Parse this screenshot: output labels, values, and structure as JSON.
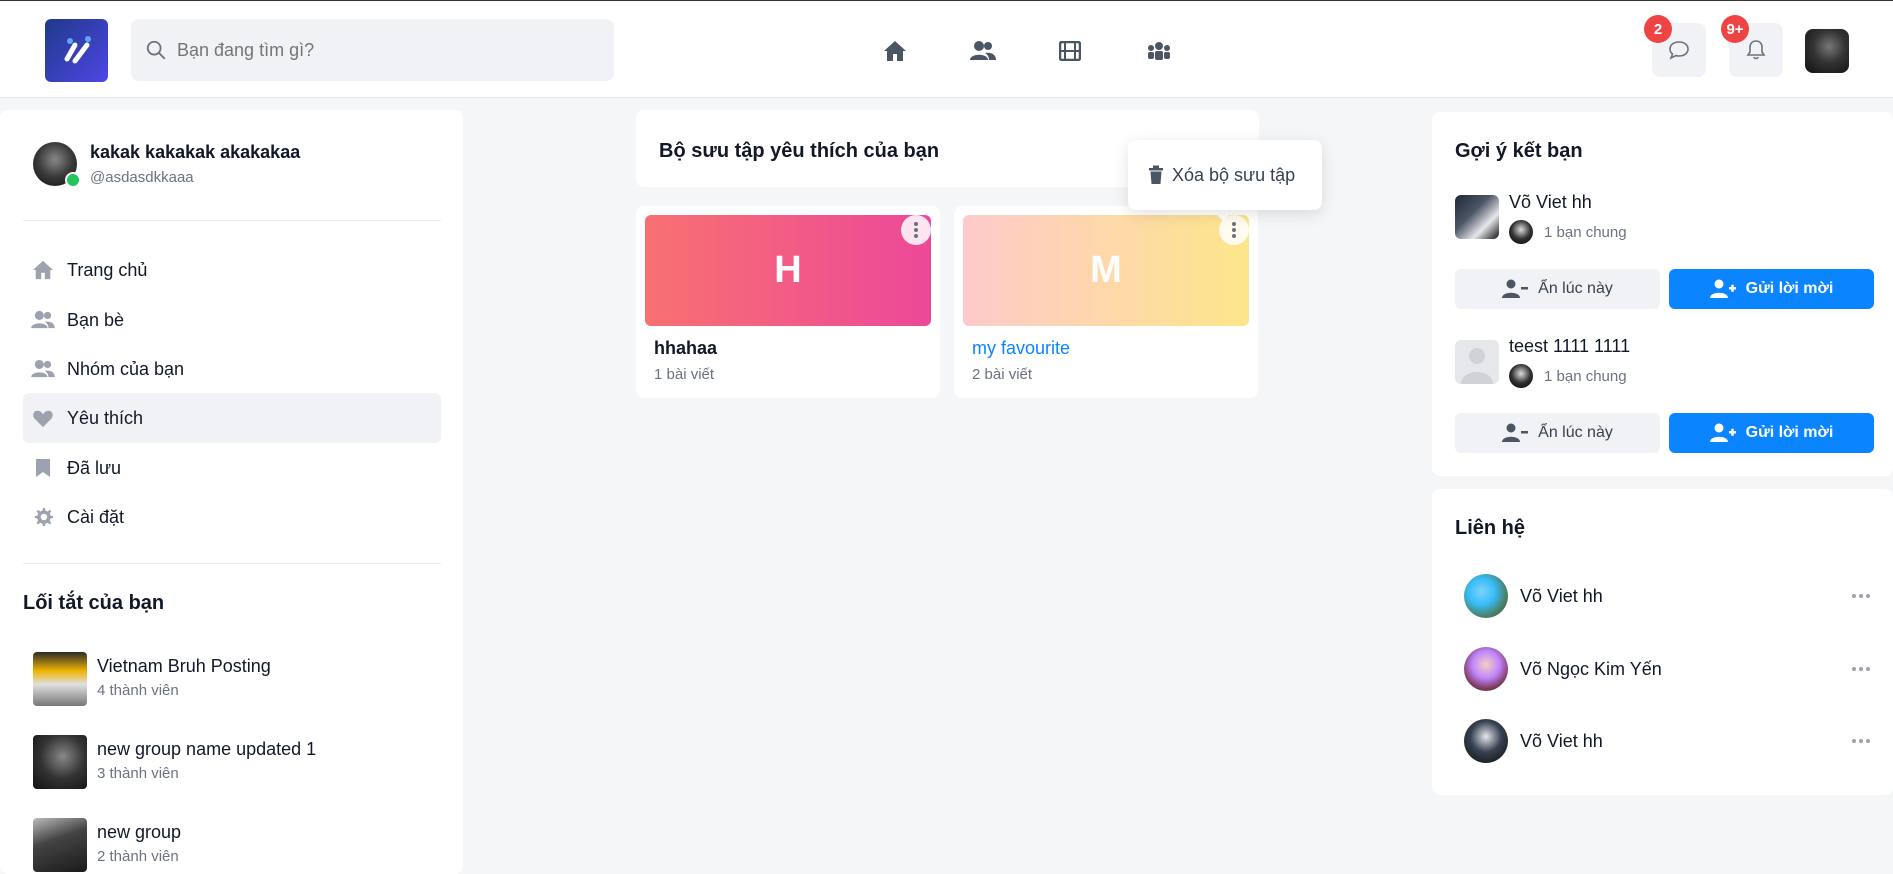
{
  "header": {
    "search_placeholder": "Bạn đang tìm gì?",
    "messages_badge": "2",
    "notifications_badge": "9+"
  },
  "profile": {
    "name": "kakak kakakak akakakaa",
    "handle": "@asdasdkkaaa"
  },
  "menu": [
    {
      "label": "Trang chủ",
      "icon": "home-icon"
    },
    {
      "label": "Bạn bè",
      "icon": "friends-icon"
    },
    {
      "label": "Nhóm của bạn",
      "icon": "groups-icon"
    },
    {
      "label": "Yêu thích",
      "icon": "heart-icon"
    },
    {
      "label": "Đã lưu",
      "icon": "bookmark-icon"
    },
    {
      "label": "Cài đặt",
      "icon": "gear-icon"
    }
  ],
  "shortcuts": {
    "title": "Lối tắt của bạn",
    "items": [
      {
        "name": "Vietnam Bruh Posting",
        "members": "4 thành viên"
      },
      {
        "name": "new group name updated 1",
        "members": "3 thành viên"
      },
      {
        "name": "new group",
        "members": "2 thành viên"
      }
    ]
  },
  "collections": {
    "title": "Bộ sưu tập yêu thích của bạn",
    "popup_label": "Xóa bộ sưu tập",
    "items": [
      {
        "initial": "H",
        "name": "hhahaa",
        "count": "1 bài viết"
      },
      {
        "initial": "M",
        "name": "my favourite",
        "count": "2 bài viết"
      }
    ]
  },
  "suggestions": {
    "title": "Gợi ý kết bạn",
    "items": [
      {
        "name": "Võ Viet hh",
        "mutual": "1 bạn chung",
        "hide_label": "Ẩn lúc này",
        "add_label": "Gửi lời mời"
      },
      {
        "name": "teest 1111 1111",
        "mutual": "1 bạn chung",
        "hide_label": "Ẩn lúc này",
        "add_label": "Gửi lời mời"
      }
    ]
  },
  "contacts": {
    "title": "Liên hệ",
    "items": [
      {
        "name": "Võ Viet hh"
      },
      {
        "name": "Võ Ngọc Kim Yến"
      },
      {
        "name": "Võ Viet hh"
      }
    ]
  },
  "colors": {
    "accent": "#0a84ff",
    "badge": "#ef4444",
    "online": "#22c55e",
    "link": "#0a84ff"
  }
}
